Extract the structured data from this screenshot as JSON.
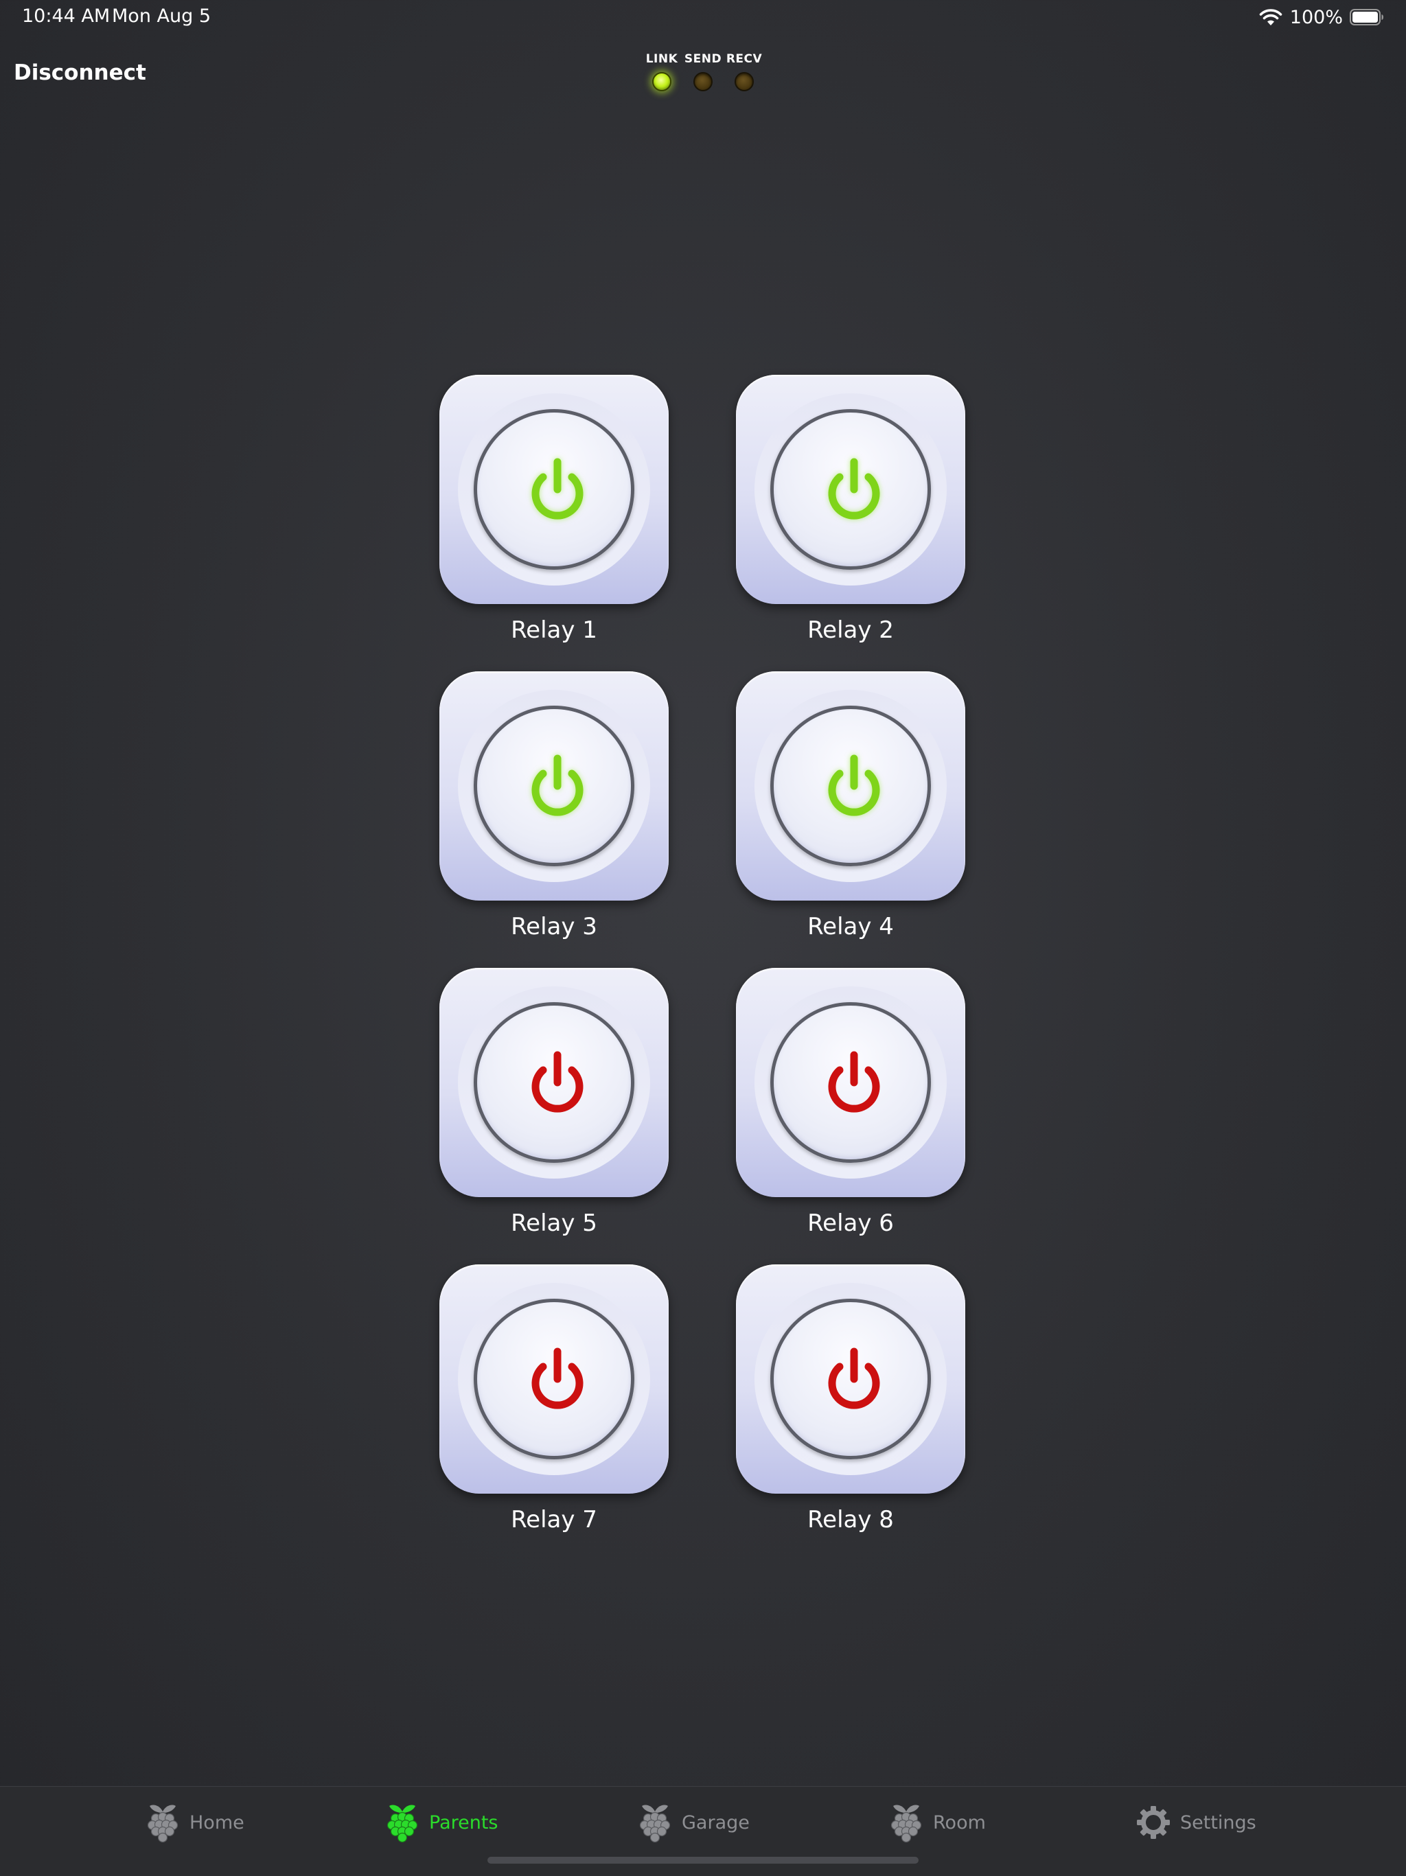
{
  "status_bar": {
    "time": "10:44 AM",
    "date": "Mon Aug 5",
    "battery": "100%"
  },
  "nav": {
    "disconnect_label": "Disconnect"
  },
  "indicators": [
    {
      "label": "LINK",
      "on": true
    },
    {
      "label": "SEND",
      "on": false
    },
    {
      "label": "RECV",
      "on": false
    }
  ],
  "relays": [
    {
      "label": "Relay 1",
      "state": "on"
    },
    {
      "label": "Relay 2",
      "state": "on"
    },
    {
      "label": "Relay 3",
      "state": "on"
    },
    {
      "label": "Relay 4",
      "state": "on"
    },
    {
      "label": "Relay 5",
      "state": "off"
    },
    {
      "label": "Relay 6",
      "state": "off"
    },
    {
      "label": "Relay 7",
      "state": "off"
    },
    {
      "label": "Relay 8",
      "state": "off"
    }
  ],
  "tabs": [
    {
      "label": "Home",
      "icon": "raspberry-icon",
      "active": false
    },
    {
      "label": "Parents",
      "icon": "raspberry-icon",
      "active": true
    },
    {
      "label": "Garage",
      "icon": "raspberry-icon",
      "active": false
    },
    {
      "label": "Room",
      "icon": "raspberry-icon",
      "active": false
    },
    {
      "label": "Settings",
      "icon": "gear-icon",
      "active": false
    }
  ],
  "colors": {
    "relay_on": "#7fd41a",
    "relay_off": "#cc1010",
    "tab_active": "#2bdc2b",
    "tab_inactive": "#8e8f93"
  }
}
